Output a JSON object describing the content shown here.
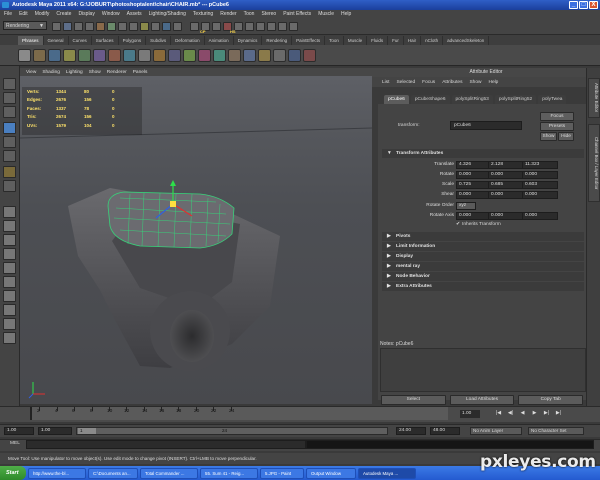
{
  "window": {
    "title": "Autodesk Maya 2011 x64: G:\\JOBURT\\photoshoptalent\\chair\\CHAIR.mb* --- pCube6",
    "buttons": [
      "_",
      "□",
      "X"
    ]
  },
  "menubar": [
    "File",
    "Edit",
    "Modify",
    "Create",
    "Display",
    "Window",
    "Assets",
    "Lighting/Shading",
    "Texturing",
    "Render",
    "Toon",
    "Stereo",
    "Paint Effects",
    "Muscle",
    "Help"
  ],
  "status_line": {
    "mode": "Rendering",
    "mode_arrow": "▼",
    "labels": [
      "CP",
      "HS"
    ]
  },
  "shelf_tabs": [
    "Phrases",
    "General",
    "Curves",
    "Surfaces",
    "Polygons",
    "Subdivs",
    "Deformation",
    "Animation",
    "Dynamics",
    "Rendering",
    "PaintEffects",
    "Toon",
    "Muscle",
    "Fluids",
    "Fur",
    "Hair",
    "nCloth",
    "advancedSkeleton"
  ],
  "viewport": {
    "menu": [
      "View",
      "Shading",
      "Lighting",
      "Show",
      "Renderer",
      "Panels"
    ],
    "hud": [
      {
        "label": "Verts:",
        "v1": "1344",
        "v2": "80",
        "v3": "0"
      },
      {
        "label": "Edges:",
        "v1": "2676",
        "v2": "156",
        "v3": "0"
      },
      {
        "label": "Faces:",
        "v1": "1337",
        "v2": "78",
        "v3": "0"
      },
      {
        "label": "Tris:",
        "v1": "2674",
        "v2": "156",
        "v3": "0"
      },
      {
        "label": "UVs:",
        "v1": "1579",
        "v2": "104",
        "v3": "0"
      }
    ]
  },
  "attribute_editor": {
    "header": "Attribute Editor",
    "menu": [
      "List",
      "Selected",
      "Focus",
      "Attributes",
      "Show",
      "Help"
    ],
    "tabs": [
      "pCube6",
      "pCubeShape6",
      "polySplitRing53",
      "polySplitRing52",
      "polyTwea"
    ],
    "transform_label": "transform:",
    "transform_value": "pCube6",
    "buttons": {
      "focus": "Focus",
      "presets": "Presets",
      "show": "Show",
      "hide": "Hide"
    },
    "section_transform": "Transform Attributes",
    "attrs": [
      {
        "label": "Translate",
        "x": "4.326",
        "y": "2.128",
        "z": "11.323"
      },
      {
        "label": "Rotate",
        "x": "0.000",
        "y": "0.000",
        "z": "0.000"
      },
      {
        "label": "Scale",
        "x": "0.725",
        "y": "0.685",
        "z": "0.603"
      },
      {
        "label": "Shear",
        "x": "0.000",
        "y": "0.000",
        "z": "0.000"
      }
    ],
    "rotate_order_label": "Rotate Order",
    "rotate_order_value": "xyz",
    "rotate_axis": {
      "label": "Rotate Axis",
      "x": "0.000",
      "y": "0.000",
      "z": "0.000"
    },
    "inherits": "Inherits Transform",
    "sections": [
      "Pivots",
      "Limit Information",
      "Display",
      "mental ray",
      "Node Behavior",
      "Extra Attributes"
    ],
    "notes_label": "Notes: pCube6",
    "bottom_buttons": [
      "Select",
      "Load Attributes",
      "Copy Tab"
    ]
  },
  "right_tabs": [
    "Attribute Editor",
    "Channel Box / Layer Editor"
  ],
  "time_slider": {
    "ticks": [
      "2",
      "4",
      "6",
      "8",
      "10",
      "12",
      "14",
      "16",
      "18",
      "20",
      "22",
      "24"
    ],
    "current": "1.00",
    "play_buttons": [
      "|◀",
      "◀|",
      "◀",
      "▶",
      "▶|",
      "▶|"
    ]
  },
  "range_slider": {
    "start": "1.00",
    "inner_start": "1.00",
    "thumb_a": "1",
    "thumb_b": "24",
    "inner_end": "24.00",
    "end": "48.00",
    "anim_layer": "No Anim Layer",
    "character_set": "No Character Set"
  },
  "command_line": {
    "label": "MEL"
  },
  "help_line": "Move Tool: Use manipulator to move object(s). Use edit mode to change pivot (INSERT). Ctrl+LMB to move perpendicular.",
  "taskbar": {
    "start": "Start",
    "tasks": [
      "http://www.the-bl...",
      "C:\\Documents an...",
      "Total Commander ...",
      "55. Sum 41 - Reig...",
      "5.JPG - Paint",
      "Output Window",
      "Autodesk Maya ..."
    ]
  },
  "watermark": "pxleyes.com"
}
